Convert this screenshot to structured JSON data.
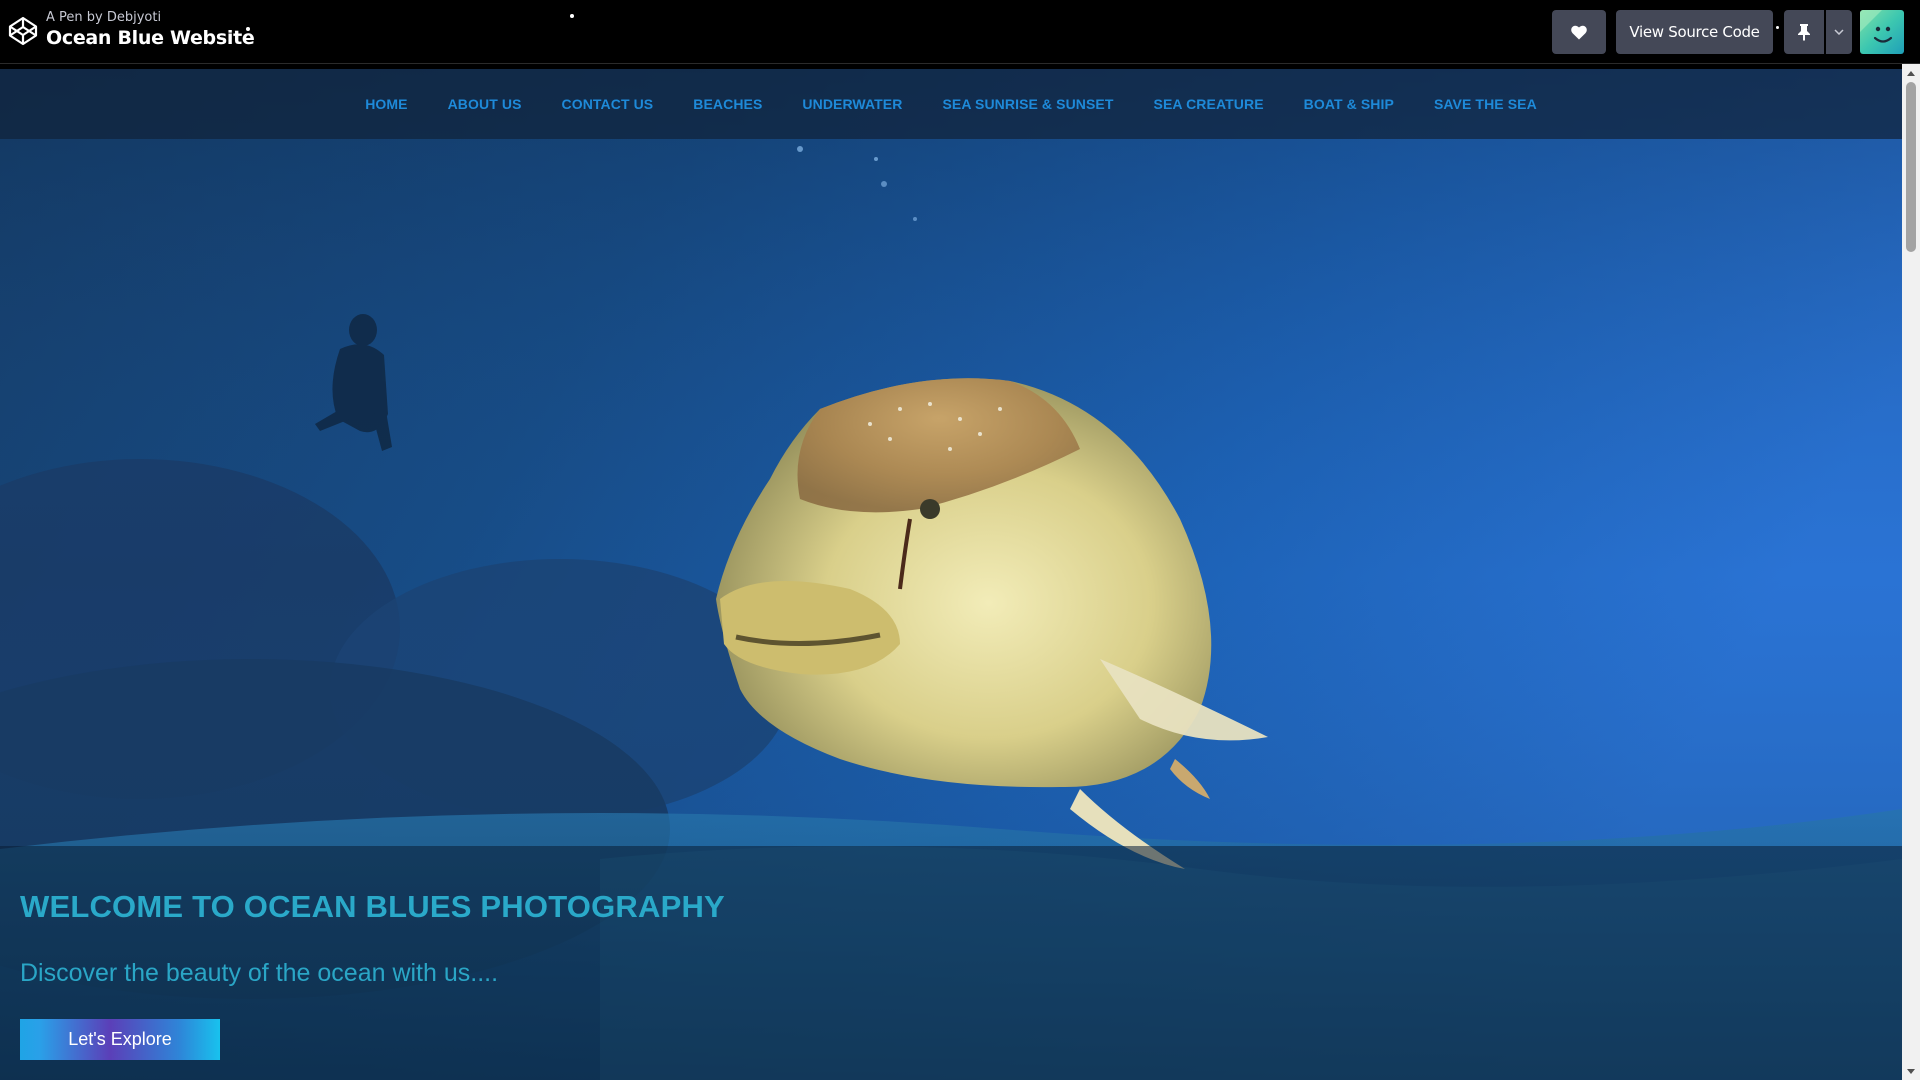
{
  "codepen": {
    "author_prefix": "A Pen by ",
    "author_name": "Debjyoti",
    "pen_title": "Ocean Blue Website",
    "view_source_label": "View Source Code",
    "icons": {
      "logo": "codepen-logo-icon",
      "heart": "heart-icon",
      "pin": "pin-icon",
      "dropdown": "chevron-down-icon",
      "avatar": "avatar"
    }
  },
  "site": {
    "nav": [
      {
        "label": "HOME"
      },
      {
        "label": "ABOUT US"
      },
      {
        "label": "CONTACT US"
      },
      {
        "label": "BEACHES"
      },
      {
        "label": "UNDERWATER"
      },
      {
        "label": "SEA SUNRISE & SUNSET"
      },
      {
        "label": "SEA CREATURE"
      },
      {
        "label": "BOAT & SHIP"
      },
      {
        "label": "SAVE THE SEA"
      }
    ],
    "hero": {
      "title": "WELCOME TO OCEAN BLUES PHOTOGRAPHY",
      "subtitle": "Discover the beauty of the ocean with us....",
      "cta_label": "Let's Explore"
    }
  },
  "colors": {
    "nav_link": "#1e8ad9",
    "hero_text": "#2aa9c9",
    "topbar_button": "#444857"
  }
}
